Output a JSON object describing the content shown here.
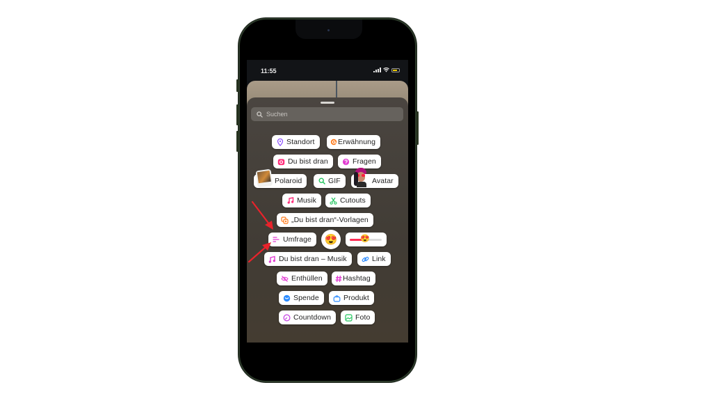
{
  "status_bar": {
    "time": "11:55"
  },
  "search": {
    "placeholder": "Suchen"
  },
  "stickers": [
    {
      "id": "standort",
      "label": "Standort",
      "icon": "location-pin-icon",
      "color": "#8a4dff"
    },
    {
      "id": "erwaehnung",
      "label": "Erwähnung",
      "icon": "mention-icon",
      "color": "#ff7a1a"
    },
    {
      "id": "du-bist-dran",
      "label": "Du bist dran",
      "icon": "camera-icon",
      "color": "#ff2d7a"
    },
    {
      "id": "fragen",
      "label": "Fragen",
      "icon": "question-icon",
      "color": "#e23bd2"
    },
    {
      "id": "polaroid",
      "label": "Polaroid",
      "icon": "polaroid-thumbnail",
      "color": "#444444"
    },
    {
      "id": "gif",
      "label": "GIF",
      "icon": "search-gif-icon",
      "color": "#22c55e"
    },
    {
      "id": "avatar",
      "label": "Avatar",
      "icon": "avatar-thumbnail",
      "color": "#e0245e"
    },
    {
      "id": "musik",
      "label": "Musik",
      "icon": "music-note-icon",
      "color": "#ff2d7a"
    },
    {
      "id": "cutouts",
      "label": "Cutouts",
      "icon": "cutouts-icon",
      "color": "#22c55e"
    },
    {
      "id": "vorlagen",
      "label": "„Du bist dran“-Vorlagen",
      "icon": "templates-icon",
      "color": "#ff7a1a"
    },
    {
      "id": "umfrage",
      "label": "Umfrage",
      "icon": "poll-icon",
      "color": "#e23bd2"
    },
    {
      "id": "emoji-reaction",
      "label": "",
      "icon": "heart-eyes-emoji",
      "color": "#ffcc33"
    },
    {
      "id": "emoji-slider",
      "label": "",
      "icon": "emoji-slider-icon",
      "color": "#ff2d55"
    },
    {
      "id": "du-bist-dran-musik",
      "label": "Du bist dran – Musik",
      "icon": "music-multi-icon",
      "color": "#e23bd2"
    },
    {
      "id": "link",
      "label": "Link",
      "icon": "link-icon",
      "color": "#2d8cff"
    },
    {
      "id": "enthuellen",
      "label": "Enthüllen",
      "icon": "eye-off-icon",
      "color": "#e23bd2"
    },
    {
      "id": "hashtag",
      "label": "Hashtag",
      "icon": "hashtag-icon",
      "color": "#e23bd2"
    },
    {
      "id": "spende",
      "label": "Spende",
      "icon": "donation-icon",
      "color": "#2d8cff"
    },
    {
      "id": "produkt",
      "label": "Produkt",
      "icon": "shopping-bag-icon",
      "color": "#2d8cff"
    },
    {
      "id": "countdown",
      "label": "Countdown",
      "icon": "countdown-icon",
      "color": "#c43be2"
    },
    {
      "id": "foto",
      "label": "Foto",
      "icon": "photo-icon",
      "color": "#22c55e"
    }
  ],
  "annotations": {
    "arrow_color": "#e8232b",
    "highlighted_sticker": "Umfrage"
  }
}
